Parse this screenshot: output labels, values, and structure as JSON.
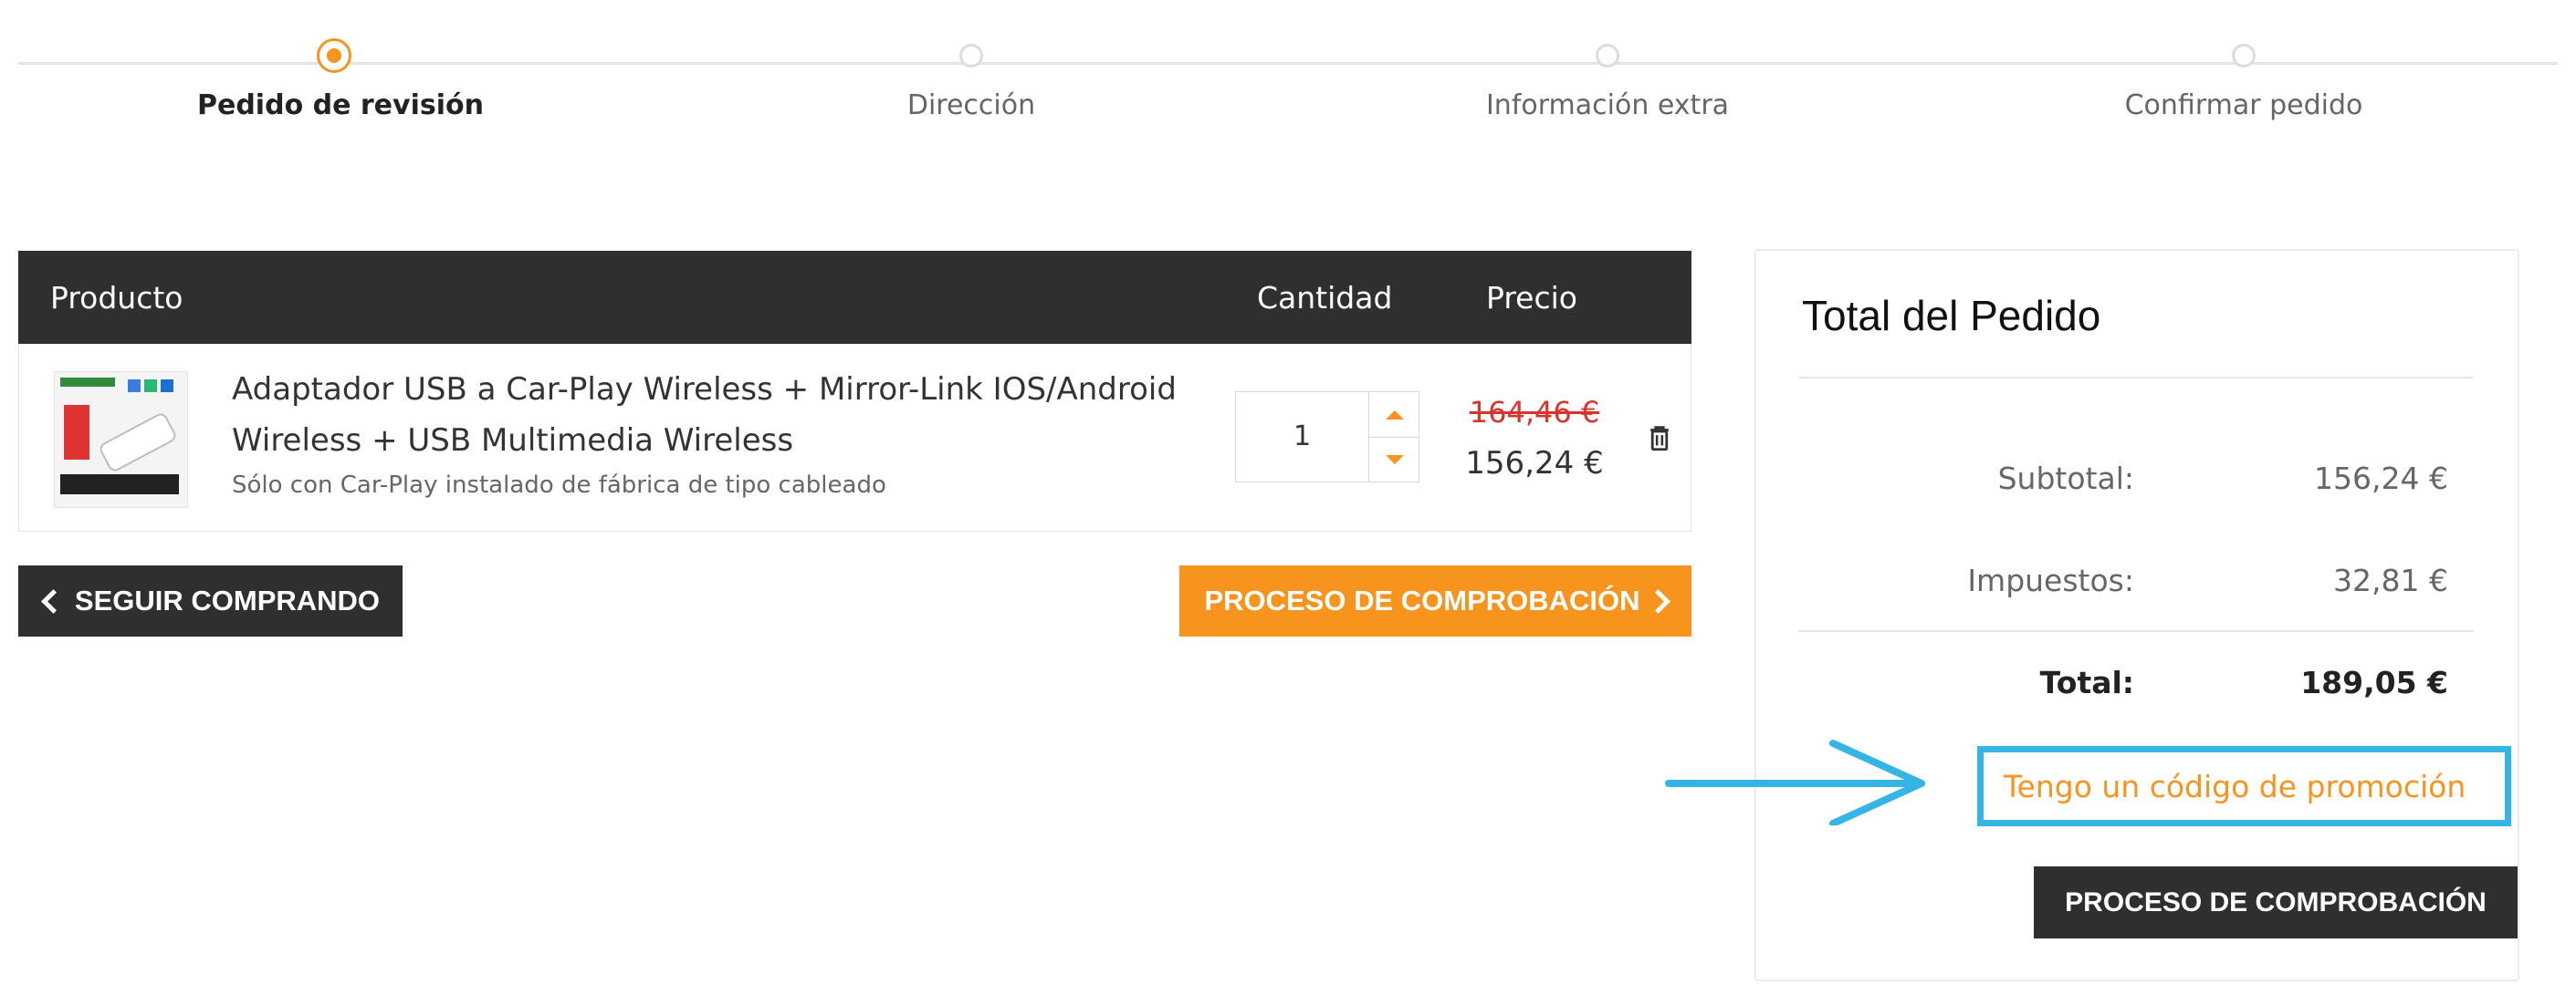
{
  "stepper": {
    "steps": [
      {
        "label": "Pedido de revisión",
        "active": true
      },
      {
        "label": "Dirección",
        "active": false
      },
      {
        "label": "Información extra",
        "active": false
      },
      {
        "label": "Confirmar pedido",
        "active": false
      }
    ]
  },
  "cart": {
    "headers": {
      "product": "Producto",
      "quantity": "Cantidad",
      "price": "Precio"
    },
    "item": {
      "name": "Adaptador USB a Car-Play Wireless + Mirror-Link IOS/Android Wireless + USB Multimedia Wireless",
      "note": "Sólo con Car-Play instalado de fábrica de tipo cableado",
      "quantity": "1",
      "old_price": "164,46 €",
      "price": "156,24 €",
      "icons": {
        "increment": "caret-up-icon",
        "decrement": "caret-down-icon",
        "remove": "trash-icon"
      }
    }
  },
  "actions": {
    "continue_shopping": "SEGUIR COMPRANDO",
    "checkout": "PROCESO DE COMPROBACIÓN"
  },
  "summary": {
    "title": "Total del Pedido",
    "subtotal_label": "Subtotal:",
    "subtotal_value": "156,24 €",
    "tax_label": "Impuestos:",
    "tax_value": "32,81 €",
    "total_label": "Total:",
    "total_value": "189,05 €",
    "promo_link": "Tengo un código de promoción",
    "checkout": "PROCESO DE COMPROBACIÓN"
  },
  "colors": {
    "accent": "#f7941d",
    "dark": "#2f2f2f",
    "highlight": "#35b4e6",
    "strike": "#d9342b"
  }
}
